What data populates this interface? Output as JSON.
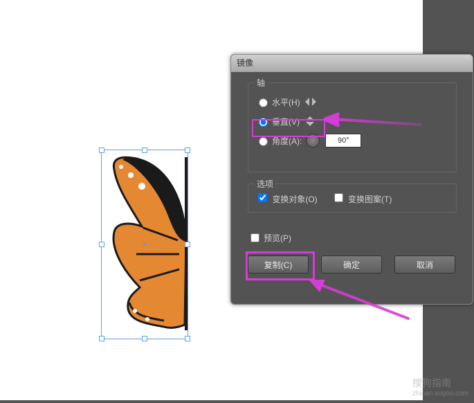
{
  "dialog": {
    "title": "镜像",
    "groups": {
      "axis": {
        "legend": "轴",
        "horizontal_label": "水平(H)",
        "vertical_label": "垂直(V)",
        "angle_label": "角度(A):",
        "angle_value": "90°",
        "selected": "vertical"
      },
      "options": {
        "legend": "选项",
        "transform_objects_label": "变换对象(O)",
        "transform_objects_checked": true,
        "transform_patterns_label": "变换图案(T)",
        "transform_patterns_checked": false
      }
    },
    "preview": {
      "label": "预览(P)",
      "checked": false
    },
    "buttons": {
      "copy": "复制(C)",
      "ok": "确定",
      "cancel": "取消"
    }
  },
  "annotations": {
    "highlight_vertical": true,
    "highlight_copy_button": true,
    "arrow_to_vertical": true,
    "arrow_to_copy": true
  },
  "canvas": {
    "object": "butterfly-half",
    "selected": true
  },
  "watermark": {
    "brand": "搜狗指南",
    "url": "zhinan.sogou.com"
  }
}
